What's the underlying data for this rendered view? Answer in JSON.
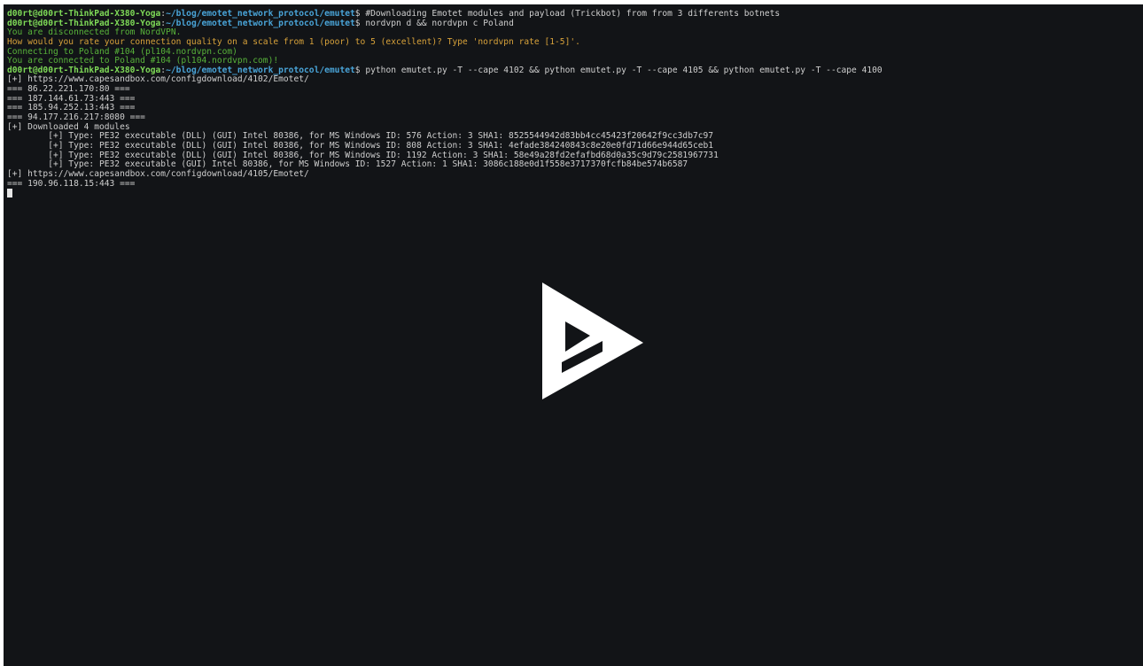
{
  "prompt": {
    "user": "d00rt@d00rt-ThinkPad-X380-Yoga",
    "path": "~/blog/emotet_network_protocol/emutet"
  },
  "lines": [
    {
      "type": "prompt",
      "cmd": "#Downloading Emotet modules and payload (Trickbot) from from 3 differents botnets"
    },
    {
      "type": "prompt",
      "cmd": "nordvpn d && nordvpn c Poland"
    },
    {
      "type": "green",
      "text": "You are disconnected from NordVPN."
    },
    {
      "type": "orange",
      "text": "How would you rate your connection quality on a scale from 1 (poor) to 5 (excellent)? Type 'nordvpn rate [1-5]'."
    },
    {
      "type": "green",
      "text": "Connecting to Poland #104 (pl104.nordvpn.com)"
    },
    {
      "type": "green",
      "text": "You are connected to Poland #104 (pl104.nordvpn.com)!"
    },
    {
      "type": "prompt",
      "cmd": "python emutet.py -T --cape 4102 && python emutet.py -T --cape 4105 && python emutet.py -T --cape 4100"
    },
    {
      "type": "plain",
      "text": "[+] https://www.capesandbox.com/configdownload/4102/Emotet/"
    },
    {
      "type": "plain",
      "text": "=== 86.22.221.170:80 ==="
    },
    {
      "type": "plain",
      "text": "=== 187.144.61.73:443 ==="
    },
    {
      "type": "plain",
      "text": "=== 185.94.252.13:443 ==="
    },
    {
      "type": "plain",
      "text": "=== 94.177.216.217:8080 ==="
    },
    {
      "type": "plain",
      "text": "[+] Downloaded 4 modules"
    },
    {
      "type": "plain",
      "text": "        [+] Type: PE32 executable (DLL) (GUI) Intel 80386, for MS Windows ID: 576 Action: 3 SHA1: 8525544942d83bb4cc45423f20642f9cc3db7c97"
    },
    {
      "type": "plain",
      "text": "        [+] Type: PE32 executable (DLL) (GUI) Intel 80386, for MS Windows ID: 808 Action: 3 SHA1: 4efade384240843c8e20e0fd71d66e944d65ceb1"
    },
    {
      "type": "plain",
      "text": "        [+] Type: PE32 executable (DLL) (GUI) Intel 80386, for MS Windows ID: 1192 Action: 3 SHA1: 58e49a28fd2efafbd68d0a35c9d79c2581967731"
    },
    {
      "type": "plain",
      "text": "        [+] Type: PE32 executable (GUI) Intel 80386, for MS Windows ID: 1527 Action: 1 SHA1: 3086c188e0d1f558e3717370fcfb84be574b6587"
    },
    {
      "type": "plain",
      "text": "[+] https://www.capesandbox.com/configdownload/4105/Emotet/"
    },
    {
      "type": "plain",
      "text": "=== 190.96.118.15:443 ==="
    },
    {
      "type": "cursor",
      "text": ""
    }
  ],
  "overlay": {
    "icon": "play-icon",
    "color": "#ffffff"
  },
  "colors": {
    "background": "#121417",
    "user": "#7ed957",
    "path": "#49a4d8",
    "text": "#cfcfcf",
    "green": "#58b33a",
    "orange": "#d8a23a"
  }
}
